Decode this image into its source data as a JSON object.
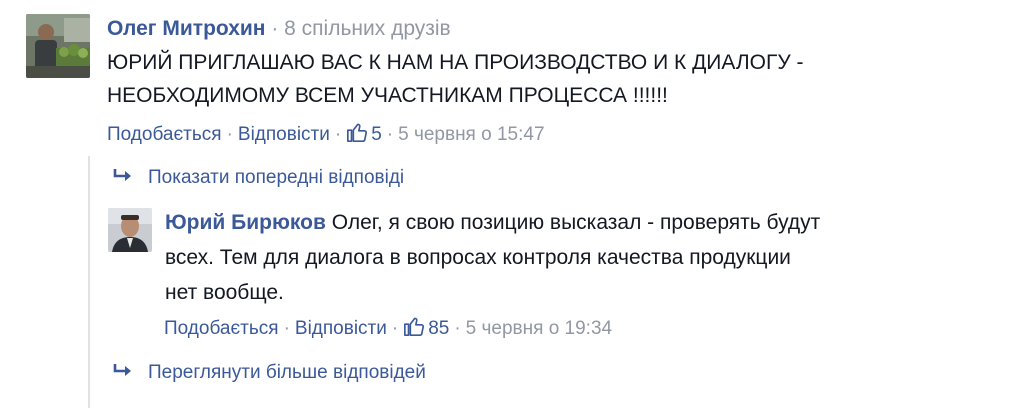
{
  "comment1": {
    "author": "Олег Митрохин",
    "mutual_friends": "8 спільних друзів",
    "text_line1": "ЮРИЙ ПРИГЛАШАЮ ВАС К НАМ НА ПРОИЗВОДСТВО И К ДИАЛОГУ -",
    "text_line2": "НЕОБХОДИМОМУ ВСЕМ УЧАСТНИКАМ ПРОЦЕССА !!!!!!",
    "like_label": "Подобається",
    "reply_label": "Відповісти",
    "likes_count": "5",
    "timestamp": "5 червня о 15:47"
  },
  "show_previous_label": "Показати попередні відповіді",
  "comment2": {
    "author": "Юрий Бирюков",
    "text_line1": "Олег, я свою позицию высказал - проверять будут",
    "text_line2": "всех. Тем для диалога в вопросах контроля качества продукции",
    "text_line3": "нет вообще.",
    "like_label": "Подобається",
    "reply_label": "Відповісти",
    "likes_count": "85",
    "timestamp": "5 червня о 19:34"
  },
  "view_more_label": "Переглянути більше відповідей",
  "colors": {
    "link": "#3b5998",
    "meta": "#9197a3",
    "text": "#141823",
    "thread_line": "#e1e2e3"
  },
  "icons": {
    "like": "thumbs-up-icon",
    "reply_arrow": "reply-arrow-icon"
  }
}
